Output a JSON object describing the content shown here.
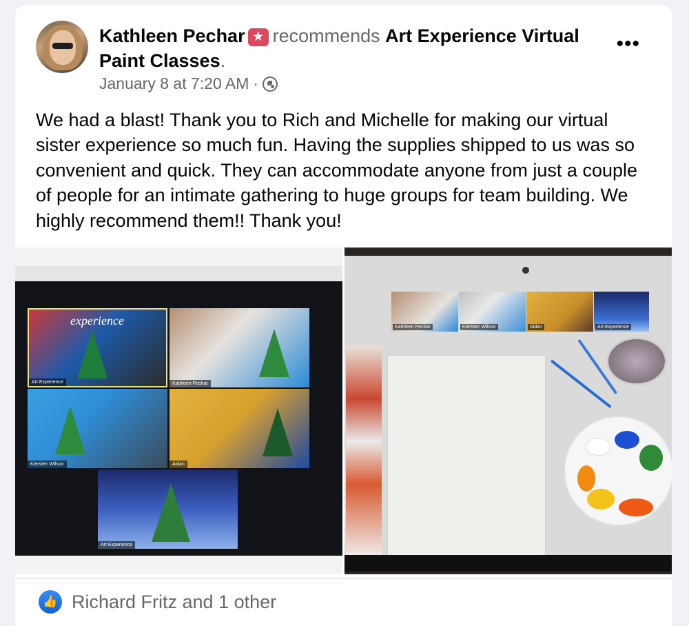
{
  "post": {
    "author": "Kathleen Pechar",
    "verb": "recommends",
    "page_name": "Art Experience Virtual Paint Classes",
    "period": ".",
    "timestamp": "January 8 at 7:20 AM",
    "separator": "·",
    "body": "We had a blast! Thank you to Rich and Michelle for making our virtual sister experience so much fun. Having the supplies shipped to us was so convenient and quick. They can accommodate anyone from just a couple of people for an intimate gathering to huge groups for team building. We highly recommend them!! Thank you!",
    "more_icon": "more-horizontal-icon",
    "privacy_icon": "globe-icon",
    "badge_icon": "star-badge-icon"
  },
  "photos": {
    "left": {
      "tiles": [
        {
          "label": "Art Experience",
          "title": "experience"
        },
        {
          "label": "Kathleen Pechar"
        },
        {
          "label": "Kiersten Wilson"
        },
        {
          "label": "Aidan"
        },
        {
          "label": "Art Experience"
        }
      ]
    },
    "right": {
      "strip": [
        {
          "label": "Kathleen Pechar"
        },
        {
          "label": "Kiersten Wilson"
        },
        {
          "label": "Aidan"
        },
        {
          "label": "Art Experience"
        }
      ]
    }
  },
  "reactions": {
    "icon": "like-icon",
    "text": "Richard Fritz and 1 other"
  },
  "colors": {
    "background": "#f0f2f5",
    "card": "#ffffff",
    "text": "#050505",
    "secondary": "#65676b",
    "like_blue": "#1877f2",
    "badge_pink": "#e0475f"
  }
}
